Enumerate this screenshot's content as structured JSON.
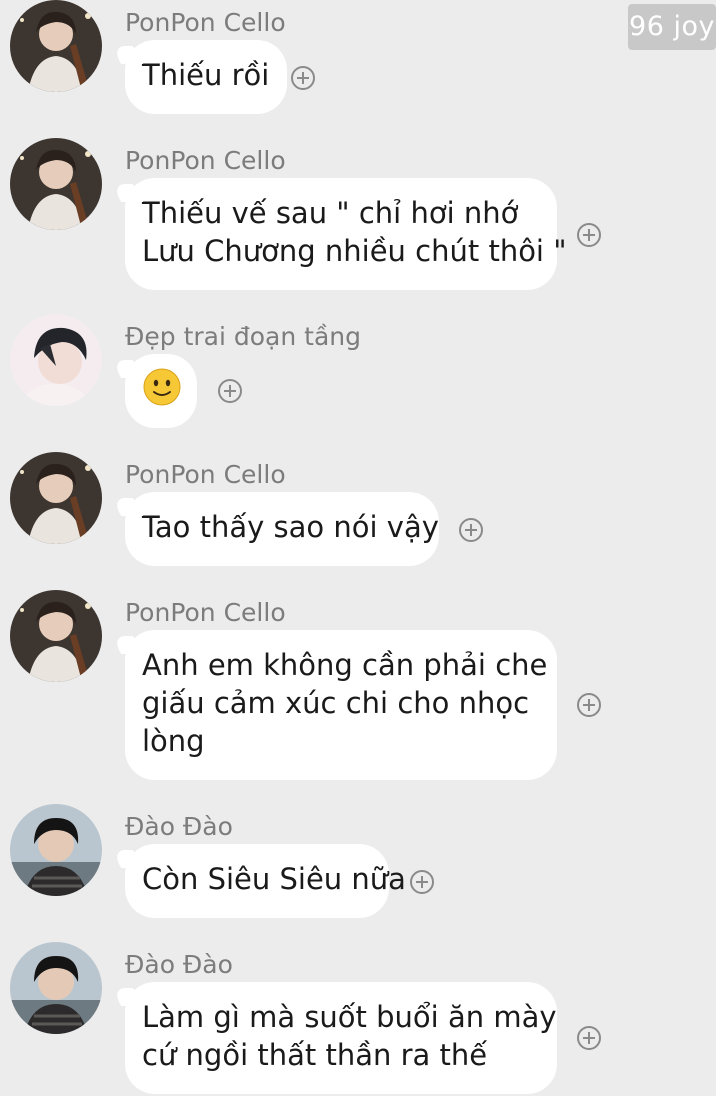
{
  "watermark": "96 joy",
  "messages": [
    {
      "sender": "PonPon Cello",
      "avatar": "cellist-avatar-icon",
      "lines": [
        "Thiếu rồi"
      ]
    },
    {
      "sender": "PonPon Cello",
      "avatar": "cellist-avatar-icon",
      "lines": [
        "Thiếu vế sau \" chỉ hơi nhớ",
        "Lưu Chương nhiều chút thôi \""
      ]
    },
    {
      "sender": "Đẹp trai đoạn tầng",
      "avatar": "portrait-avatar-icon",
      "emoji": "slightly-smiling-face-icon"
    },
    {
      "sender": "PonPon Cello",
      "avatar": "cellist-avatar-icon",
      "lines": [
        "Tao thấy sao nói vậy"
      ]
    },
    {
      "sender": "PonPon Cello",
      "avatar": "cellist-avatar-icon",
      "lines": [
        "Anh em không cần phải che",
        "giấu cảm xúc chi cho nhọc",
        "lòng"
      ]
    },
    {
      "sender": "Đào Đào",
      "avatar": "beach-portrait-avatar-icon",
      "lines": [
        "Còn Siêu Siêu nữa"
      ]
    },
    {
      "sender": "Đào Đào",
      "avatar": "beach-portrait-avatar-icon",
      "lines": [
        "Làm gì mà suốt buổi ăn mày",
        "cứ ngồi thất thần ra thế"
      ]
    }
  ]
}
